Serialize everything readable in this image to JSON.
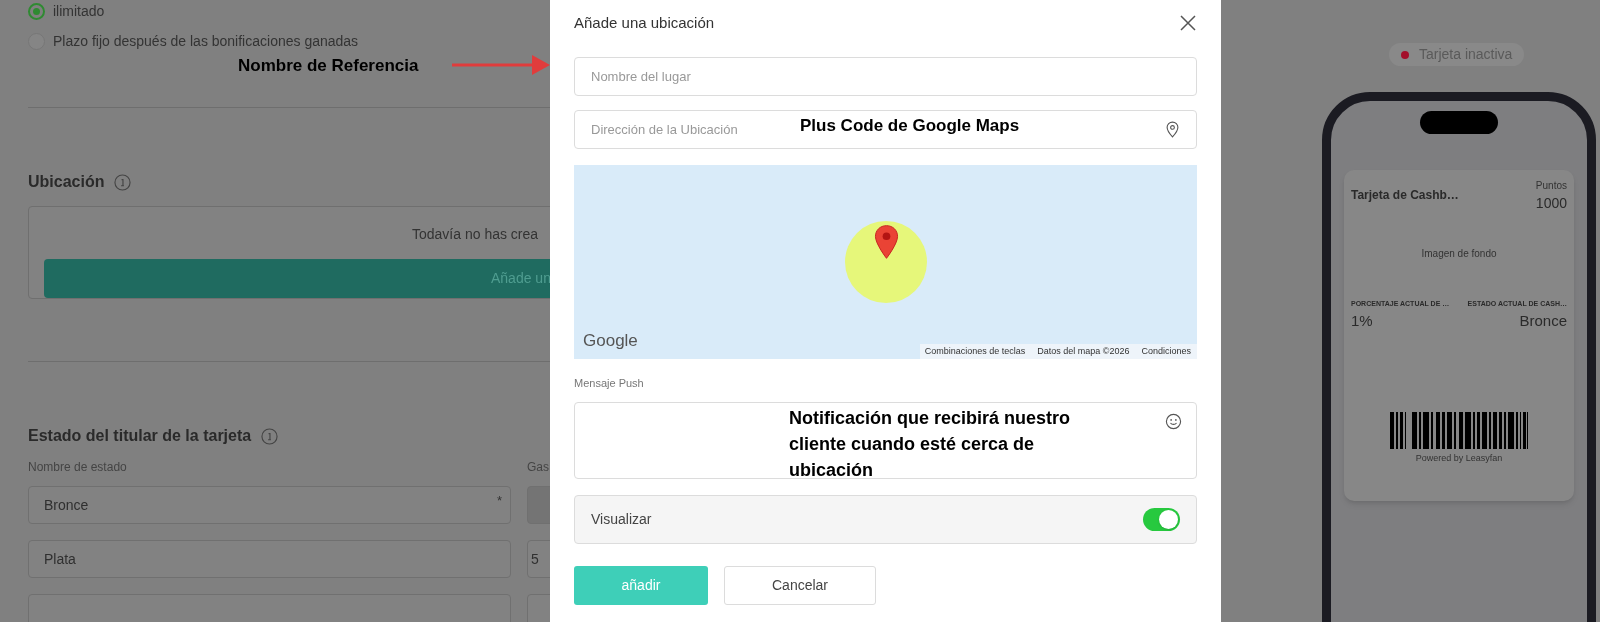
{
  "background_page": {
    "radio_options": [
      {
        "label": "ilimitado",
        "selected": true
      },
      {
        "label": "Plazo fijo después de las bonificaciones ganadas",
        "selected": false
      }
    ],
    "location_section": {
      "title": "Ubicación",
      "empty_message": "Todavía no has crea",
      "add_button": "Añade un"
    },
    "status_section": {
      "title": "Estado del titular de la tarjeta",
      "columns": [
        "Nombre de estado",
        "Gas"
      ],
      "rows": [
        {
          "name": "Bronce",
          "required_mark": "*",
          "disabled": true
        },
        {
          "name": "Plata",
          "value": "5",
          "disabled": false
        }
      ]
    }
  },
  "preview": {
    "status_badge": "Tarjeta inactiva",
    "card": {
      "title": "Tarjeta de Cashb…",
      "points_label": "Puntos",
      "points": "1000",
      "background_label": "Imagen de fondo",
      "fields": [
        {
          "label": "PORCENTAJE ACTUAL DE …",
          "value": "1%"
        },
        {
          "label": "ESTADO ACTUAL DE CASH…",
          "value": "Bronce"
        }
      ],
      "footer": "Powered by Leasyfan"
    }
  },
  "modal": {
    "title": "Añade una ubicación",
    "name_field": {
      "placeholder": "Nombre del lugar"
    },
    "address_field": {
      "placeholder": "Dirección de la Ubicación"
    },
    "map": {
      "logo": "Google",
      "attributions": [
        "Combinaciones de teclas",
        "Datos del mapa ©2026",
        "Condiciones"
      ]
    },
    "push_label": "Mensaje Push",
    "visualize": {
      "label": "Visualizar",
      "on": true
    },
    "buttons": [
      {
        "label": "añadir",
        "kind": "primary"
      },
      {
        "label": "Cancelar",
        "kind": "secondary"
      }
    ]
  },
  "annotations": [
    "Nombre de Referencia",
    "Plus Code de Google Maps",
    "Notificación que recibirá nuestro cliente cuando esté cerca de ubicación"
  ]
}
